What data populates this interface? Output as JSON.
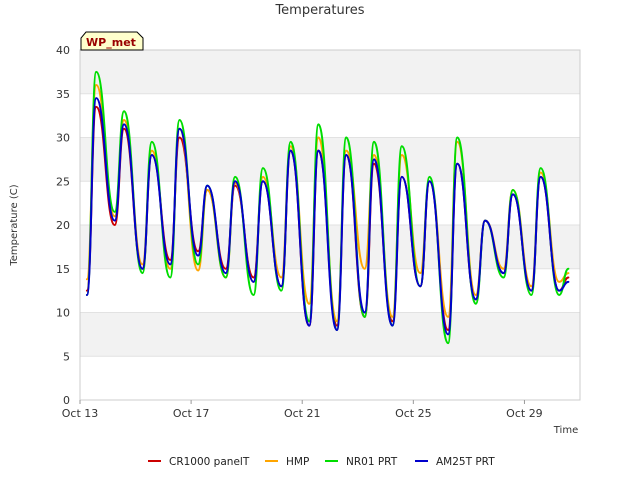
{
  "chart_data": {
    "type": "line",
    "title": "Temperatures",
    "xlabel": "Time",
    "ylabel": "Temperature (C)",
    "badge": "WP_met",
    "xlim": [
      "2023-10-13",
      "2023-10-31"
    ],
    "ylim": [
      0,
      40
    ],
    "y_ticks": [
      0,
      5,
      10,
      15,
      20,
      25,
      30,
      35,
      40
    ],
    "x_ticks": [
      {
        "date": "2023-10-13",
        "label": "Oct 13"
      },
      {
        "date": "2023-10-17",
        "label": "Oct 17"
      },
      {
        "date": "2023-10-21",
        "label": "Oct 21"
      },
      {
        "date": "2023-10-25",
        "label": "Oct 25"
      },
      {
        "date": "2023-10-29",
        "label": "Oct 29"
      }
    ],
    "grid": "horizontal bands",
    "legend_position": "bottom",
    "series": [
      {
        "name": "CR1000 panelT",
        "color": "#cc0000",
        "x": [
          "2023-10-13 06:00",
          "2023-10-13 14:00",
          "2023-10-14 06:00",
          "2023-10-14 14:00",
          "2023-10-15 06:00",
          "2023-10-15 14:00",
          "2023-10-16 06:00",
          "2023-10-16 14:00",
          "2023-10-17 06:00",
          "2023-10-17 14:00",
          "2023-10-18 06:00",
          "2023-10-18 14:00",
          "2023-10-19 06:00",
          "2023-10-19 14:00",
          "2023-10-20 06:00",
          "2023-10-20 14:00",
          "2023-10-21 06:00",
          "2023-10-21 14:00",
          "2023-10-22 06:00",
          "2023-10-22 14:00",
          "2023-10-23 06:00",
          "2023-10-23 14:00",
          "2023-10-24 06:00",
          "2023-10-24 14:00",
          "2023-10-25 06:00",
          "2023-10-25 14:00",
          "2023-10-26 06:00",
          "2023-10-26 14:00",
          "2023-10-27 06:00",
          "2023-10-27 14:00",
          "2023-10-28 06:00",
          "2023-10-28 14:00",
          "2023-10-29 06:00",
          "2023-10-29 14:00",
          "2023-10-30 06:00",
          "2023-10-30 14:00"
        ],
        "y": [
          12.5,
          33.5,
          20.0,
          31.0,
          15.0,
          28.0,
          16.0,
          30.0,
          17.0,
          24.0,
          15.0,
          24.5,
          14.0,
          25.0,
          13.0,
          28.5,
          8.5,
          28.5,
          8.5,
          28.0,
          9.5,
          27.0,
          9.0,
          25.5,
          13.0,
          25.0,
          8.0,
          27.0,
          11.5,
          20.5,
          14.5,
          23.5,
          12.5,
          25.5,
          12.5,
          14.0
        ]
      },
      {
        "name": "HMP",
        "color": "#ffa500",
        "x": [
          "2023-10-13 06:00",
          "2023-10-13 14:00",
          "2023-10-14 06:00",
          "2023-10-14 14:00",
          "2023-10-15 06:00",
          "2023-10-15 14:00",
          "2023-10-16 06:00",
          "2023-10-16 14:00",
          "2023-10-17 06:00",
          "2023-10-17 14:00",
          "2023-10-18 06:00",
          "2023-10-18 14:00",
          "2023-10-19 06:00",
          "2023-10-19 14:00",
          "2023-10-20 06:00",
          "2023-10-20 14:00",
          "2023-10-21 06:00",
          "2023-10-21 14:00",
          "2023-10-22 06:00",
          "2023-10-22 14:00",
          "2023-10-23 06:00",
          "2023-10-23 14:00",
          "2023-10-24 06:00",
          "2023-10-24 14:00",
          "2023-10-25 06:00",
          "2023-10-25 14:00",
          "2023-10-26 06:00",
          "2023-10-26 14:00",
          "2023-10-27 06:00",
          "2023-10-27 14:00",
          "2023-10-28 06:00",
          "2023-10-28 14:00",
          "2023-10-29 06:00",
          "2023-10-29 14:00",
          "2023-10-30 06:00",
          "2023-10-30 14:00"
        ],
        "y": [
          13.8,
          36.0,
          21.0,
          32.0,
          15.5,
          28.5,
          15.0,
          31.0,
          14.8,
          24.0,
          14.0,
          24.8,
          13.5,
          25.5,
          14.0,
          29.0,
          11.0,
          30.0,
          9.0,
          28.5,
          15.0,
          28.0,
          9.5,
          28.0,
          14.5,
          25.0,
          9.5,
          29.5,
          12.0,
          20.5,
          15.0,
          24.0,
          13.0,
          26.0,
          13.5,
          14.5
        ]
      },
      {
        "name": "NR01 PRT",
        "color": "#00dd00",
        "x": [
          "2023-10-13 06:00",
          "2023-10-13 14:00",
          "2023-10-14 06:00",
          "2023-10-14 14:00",
          "2023-10-15 06:00",
          "2023-10-15 14:00",
          "2023-10-16 06:00",
          "2023-10-16 14:00",
          "2023-10-17 06:00",
          "2023-10-17 14:00",
          "2023-10-18 06:00",
          "2023-10-18 14:00",
          "2023-10-19 06:00",
          "2023-10-19 14:00",
          "2023-10-20 06:00",
          "2023-10-20 14:00",
          "2023-10-21 06:00",
          "2023-10-21 14:00",
          "2023-10-22 06:00",
          "2023-10-22 14:00",
          "2023-10-23 06:00",
          "2023-10-23 14:00",
          "2023-10-24 06:00",
          "2023-10-24 14:00",
          "2023-10-25 06:00",
          "2023-10-25 14:00",
          "2023-10-26 06:00",
          "2023-10-26 14:00",
          "2023-10-27 06:00",
          "2023-10-27 14:00",
          "2023-10-28 06:00",
          "2023-10-28 14:00",
          "2023-10-29 06:00",
          "2023-10-29 14:00",
          "2023-10-30 06:00",
          "2023-10-30 14:00"
        ],
        "y": [
          12.0,
          37.5,
          21.5,
          33.0,
          14.5,
          29.5,
          14.0,
          32.0,
          15.5,
          24.5,
          14.0,
          25.5,
          12.0,
          26.5,
          12.5,
          29.5,
          9.0,
          31.5,
          8.0,
          30.0,
          9.5,
          29.5,
          8.5,
          29.0,
          13.0,
          25.5,
          6.5,
          30.0,
          11.0,
          20.5,
          14.0,
          24.0,
          12.0,
          26.5,
          12.0,
          15.0
        ]
      },
      {
        "name": "AM25T PRT",
        "color": "#0000cc",
        "x": [
          "2023-10-13 06:00",
          "2023-10-13 14:00",
          "2023-10-14 06:00",
          "2023-10-14 14:00",
          "2023-10-15 06:00",
          "2023-10-15 14:00",
          "2023-10-16 06:00",
          "2023-10-16 14:00",
          "2023-10-17 06:00",
          "2023-10-17 14:00",
          "2023-10-18 06:00",
          "2023-10-18 14:00",
          "2023-10-19 06:00",
          "2023-10-19 14:00",
          "2023-10-20 06:00",
          "2023-10-20 14:00",
          "2023-10-21 06:00",
          "2023-10-21 14:00",
          "2023-10-22 06:00",
          "2023-10-22 14:00",
          "2023-10-23 06:00",
          "2023-10-23 14:00",
          "2023-10-24 06:00",
          "2023-10-24 14:00",
          "2023-10-25 06:00",
          "2023-10-25 14:00",
          "2023-10-26 06:00",
          "2023-10-26 14:00",
          "2023-10-27 06:00",
          "2023-10-27 14:00",
          "2023-10-28 06:00",
          "2023-10-28 14:00",
          "2023-10-29 06:00",
          "2023-10-29 14:00",
          "2023-10-30 06:00",
          "2023-10-30 14:00"
        ],
        "y": [
          12.0,
          34.5,
          20.5,
          31.5,
          15.0,
          28.0,
          15.5,
          31.0,
          16.5,
          24.5,
          14.5,
          25.0,
          13.5,
          25.0,
          13.0,
          28.5,
          8.5,
          28.5,
          8.0,
          28.0,
          10.0,
          27.5,
          8.5,
          25.5,
          13.0,
          25.0,
          7.5,
          27.0,
          11.5,
          20.5,
          14.5,
          23.5,
          12.5,
          25.5,
          12.5,
          13.5
        ]
      }
    ]
  }
}
